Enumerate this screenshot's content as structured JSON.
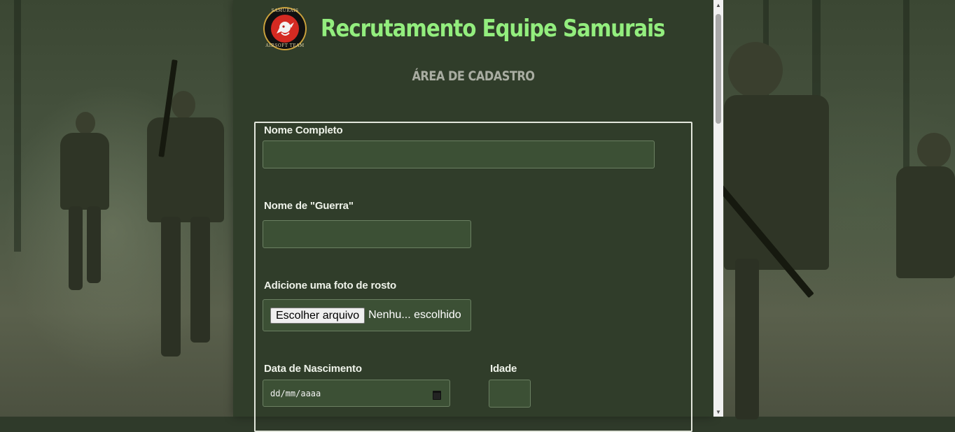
{
  "header": {
    "logo_text_top": "SAMURAIS",
    "logo_text_bottom": "AIRSOFT TEAM",
    "title": "Recrutamento Equipe Samurais",
    "title_color": "#93ee7e"
  },
  "subtitle": "ÁREA DE CADASTRO",
  "form": {
    "full_name": {
      "label": "Nome Completo",
      "value": ""
    },
    "war_name": {
      "label": "Nome de \"Guerra\"",
      "value": ""
    },
    "photo": {
      "label": "Adicione uma foto de rosto",
      "button": "Escolher arquivo",
      "status": "Nenhu... escolhido"
    },
    "birth_date": {
      "label": "Data de Nascimento",
      "placeholder": "dd/mm/aaaa"
    },
    "age": {
      "label": "Idade",
      "value": ""
    }
  },
  "icons": {
    "calendar": "calendar-icon",
    "scroll_up": "chevron-up-icon",
    "scroll_down": "chevron-down-icon"
  },
  "colors": {
    "panel": "#303d2a",
    "field": "#3c5035",
    "label": "#eef2e9"
  }
}
